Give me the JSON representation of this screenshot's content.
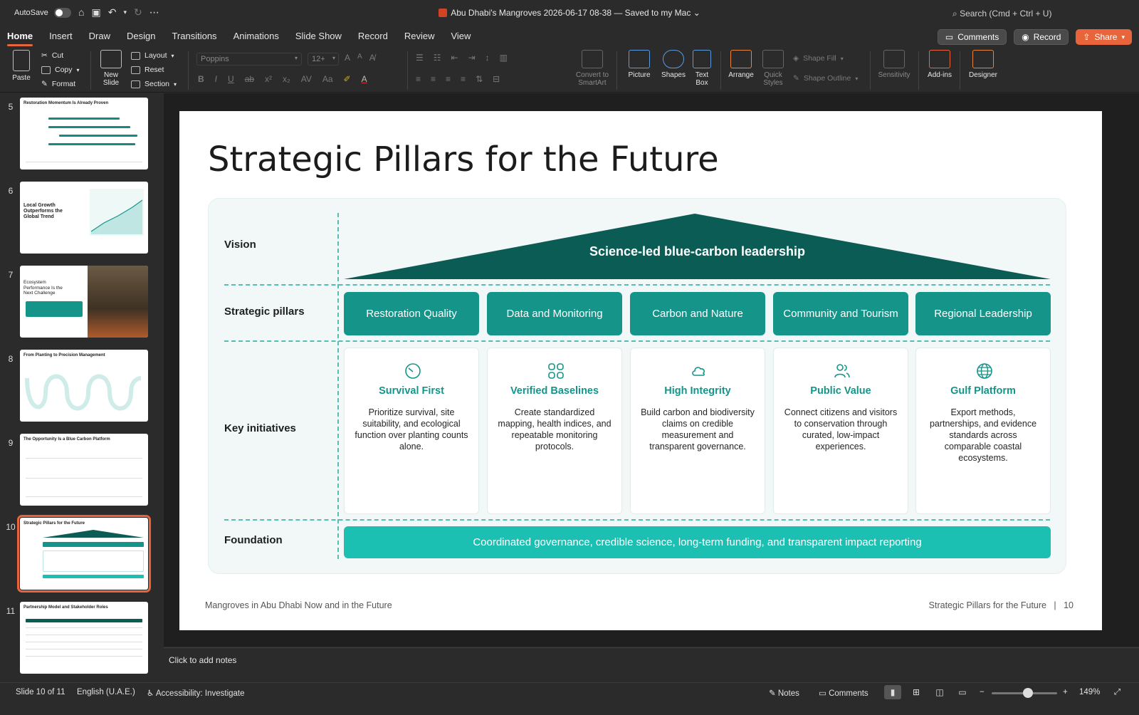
{
  "titlebar": {
    "autosave_label": "AutoSave",
    "doc_title": "Abu Dhabi's Mangroves 2026-06-17 08-38 — Saved to my Mac",
    "search_placeholder": "Search (Cmd + Ctrl + U)"
  },
  "tabs": [
    "Home",
    "Insert",
    "Draw",
    "Design",
    "Transitions",
    "Animations",
    "Slide Show",
    "Record",
    "Review",
    "View"
  ],
  "top_buttons": {
    "comments": "Comments",
    "record": "Record",
    "share": "Share"
  },
  "ribbon": {
    "paste": "Paste",
    "cut": "Cut",
    "copy": "Copy",
    "format": "Format",
    "new_slide_1": "New",
    "new_slide_2": "Slide",
    "layout": "Layout",
    "reset": "Reset",
    "section": "Section",
    "font_name": "Poppins",
    "font_size": "12+",
    "convert_1": "Convert to",
    "convert_2": "SmartArt",
    "picture": "Picture",
    "shapes": "Shapes",
    "textbox_1": "Text",
    "textbox_2": "Box",
    "arrange": "Arrange",
    "quick_1": "Quick",
    "quick_2": "Styles",
    "shape_fill": "Shape Fill",
    "shape_outline": "Shape Outline",
    "sensitivity": "Sensitivity",
    "addins": "Add-ins",
    "designer": "Designer"
  },
  "thumbnails": [
    {
      "num": "5",
      "title": "Restoration Momentum Is Already Proven"
    },
    {
      "num": "6",
      "title": "Local Growth Outperforms the Global Trend"
    },
    {
      "num": "7",
      "title": "Ecosystem Performance Is the Next Challenge"
    },
    {
      "num": "8",
      "title": "From Planting to Precision Management"
    },
    {
      "num": "9",
      "title": "The Opportunity Is a Blue Carbon Platform"
    },
    {
      "num": "10",
      "title": "Strategic Pillars for the Future"
    },
    {
      "num": "11",
      "title": "Partnership Model and Stakeholder Roles"
    }
  ],
  "slide": {
    "title": "Strategic Pillars for the Future",
    "labels": {
      "vision": "Vision",
      "pillars": "Strategic pillars",
      "initiatives": "Key initiatives",
      "foundation": "Foundation"
    },
    "vision_text": "Science-led blue-carbon leadership",
    "pillars": [
      "Restoration Quality",
      "Data and Monitoring",
      "Carbon and Nature",
      "Community and Tourism",
      "Regional Leadership"
    ],
    "initiatives": [
      {
        "icon": "dial-icon",
        "title": "Survival First",
        "body": "Prioritize survival, site suitability, and ecological function over planting counts alone."
      },
      {
        "icon": "grid-icon",
        "title": "Verified Baselines",
        "body": "Create standardized mapping, health indices, and repeatable monitoring protocols."
      },
      {
        "icon": "cloud-icon",
        "title": "High Integrity",
        "body": "Build carbon and biodiversity claims on credible measurement and transparent governance."
      },
      {
        "icon": "people-icon",
        "title": "Public Value",
        "body": "Connect citizens and visitors to conservation through curated, low-impact experiences."
      },
      {
        "icon": "globe-icon",
        "title": "Gulf Platform",
        "body": "Export methods, partnerships, and evidence standards across comparable coastal ecosystems."
      }
    ],
    "foundation_text": "Coordinated governance, credible science, long-term funding, and transparent impact reporting",
    "footer_left": "Mangroves in Abu Dhabi Now and in the Future",
    "footer_right": "Strategic Pillars for the Future   |   10"
  },
  "notes_placeholder": "Click to add notes",
  "status": {
    "slide_count": "Slide 10 of 11",
    "language": "English (U.A.E.)",
    "accessibility": "Accessibility: Investigate",
    "notes": "Notes",
    "comments": "Comments",
    "zoom": "149%"
  },
  "colors": {
    "accent": "#e8643a",
    "teal_dark": "#0b5c55",
    "teal": "#15958a",
    "teal_light": "#1cc0b2"
  }
}
